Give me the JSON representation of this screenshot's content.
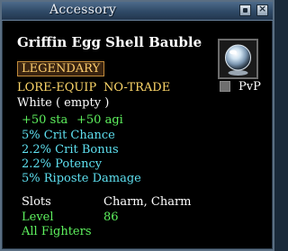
{
  "window": {
    "title": "Accessory",
    "minimize_label": "▪",
    "close_label": "×"
  },
  "item": {
    "name": "Griffin Egg Shell Bauble",
    "tier": "LEGENDARY",
    "flags": [
      "LORE-EQUIP",
      "NO-TRADE"
    ],
    "adornment": "White ( empty )",
    "pvp_label": "PvP",
    "stats": [
      "+50 sta",
      "+50 agi"
    ],
    "effects": [
      "5% Crit Chance",
      "2.2% Crit Bonus",
      "2.2% Potency",
      "5% Riposte Damage"
    ],
    "slots": {
      "label": "Slots",
      "value": "Charm, Charm"
    },
    "level": {
      "label": "Level",
      "value": "86"
    },
    "classes": "All Fighters"
  },
  "colors": {
    "name": "#ffffff",
    "tier": "#ffcf6e",
    "flags": "#ffd86a",
    "stats": "#5ef25e",
    "effects": "#5ee0f0",
    "level": "#5ef25e"
  },
  "icons": {
    "item_icon": "crystal-orb-icon"
  }
}
